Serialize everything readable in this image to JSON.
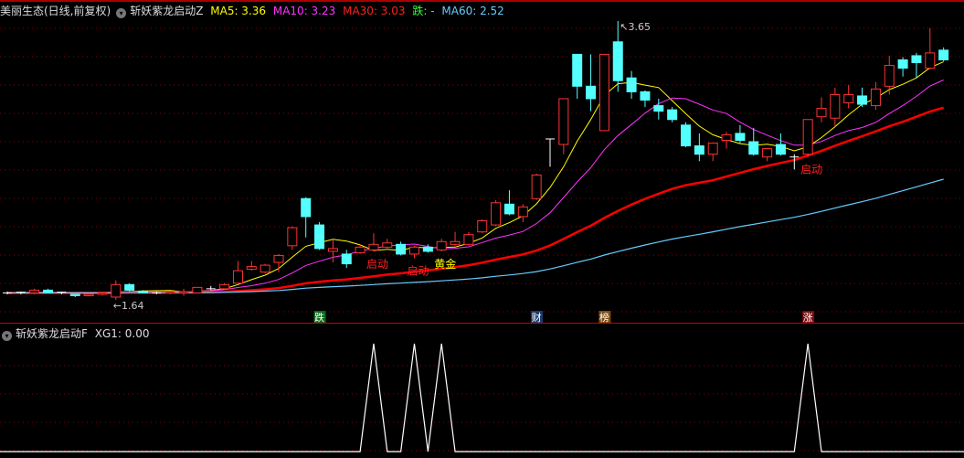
{
  "header": {
    "stock": "美丽生态(日线,前复权)",
    "indicator": "斩妖紫龙启动Z",
    "ma5_label": "MA5: 3.36",
    "ma10_label": "MA10: 3.23",
    "ma30_label": "MA30: 3.03",
    "die_label": "跌: -",
    "ma60_label": "MA60: 2.52"
  },
  "sub_header": {
    "indicator": "斩妖紫龙启动F",
    "xg1_label": "XG1: 0.00"
  },
  "colors": {
    "up": "#ff3333",
    "down": "#54ffff",
    "ma5": "#ffff00",
    "ma10": "#ff33ff",
    "ma30": "#ff0000",
    "ma60": "#66ccff",
    "grid": "#8b0000",
    "xg1": "#ffffff"
  },
  "chart_data": {
    "type": "candlestick",
    "ylim": [
      1.55,
      3.7
    ],
    "high_label": "3.65",
    "low_label": "1.64",
    "ohlc": [
      [
        1.69,
        1.7,
        1.68,
        1.69
      ],
      [
        1.69,
        1.7,
        1.68,
        1.695
      ],
      [
        1.69,
        1.72,
        1.68,
        1.71
      ],
      [
        1.71,
        1.72,
        1.69,
        1.69
      ],
      [
        1.69,
        1.7,
        1.68,
        1.695
      ],
      [
        1.68,
        1.68,
        1.66,
        1.67
      ],
      [
        1.67,
        1.69,
        1.67,
        1.68
      ],
      [
        1.68,
        1.69,
        1.67,
        1.69
      ],
      [
        1.66,
        1.78,
        1.64,
        1.75
      ],
      [
        1.75,
        1.76,
        1.7,
        1.71
      ],
      [
        1.7,
        1.71,
        1.69,
        1.69
      ],
      [
        1.69,
        1.7,
        1.68,
        1.69
      ],
      [
        1.69,
        1.7,
        1.68,
        1.7
      ],
      [
        1.69,
        1.72,
        1.67,
        1.7
      ],
      [
        1.69,
        1.73,
        1.69,
        1.73
      ],
      [
        1.72,
        1.74,
        1.71,
        1.72
      ],
      [
        1.72,
        1.76,
        1.71,
        1.75
      ],
      [
        1.76,
        1.92,
        1.76,
        1.85
      ],
      [
        1.86,
        1.92,
        1.85,
        1.88
      ],
      [
        1.84,
        1.9,
        1.83,
        1.89
      ],
      [
        1.91,
        1.97,
        1.84,
        1.96
      ],
      [
        2.03,
        2.17,
        2.0,
        2.16
      ],
      [
        2.37,
        2.38,
        2.09,
        2.24
      ],
      [
        2.18,
        2.2,
        2.0,
        2.01
      ],
      [
        1.99,
        2.07,
        1.91,
        2.01
      ],
      [
        1.97,
        2.0,
        1.87,
        1.9
      ],
      [
        1.98,
        2.04,
        1.97,
        2.02
      ],
      [
        2.0,
        2.12,
        1.99,
        2.04
      ],
      [
        2.02,
        2.08,
        2.0,
        2.05
      ],
      [
        2.04,
        2.06,
        1.96,
        1.97
      ],
      [
        1.97,
        2.03,
        1.94,
        2.02
      ],
      [
        2.02,
        2.04,
        1.98,
        1.99
      ],
      [
        2.0,
        2.08,
        1.99,
        2.06
      ],
      [
        2.04,
        2.13,
        2.03,
        2.06
      ],
      [
        2.04,
        2.13,
        2.03,
        2.11
      ],
      [
        2.13,
        2.22,
        2.12,
        2.21
      ],
      [
        2.18,
        2.36,
        2.17,
        2.34
      ],
      [
        2.33,
        2.43,
        2.25,
        2.26
      ],
      [
        2.24,
        2.33,
        2.2,
        2.31
      ],
      [
        2.37,
        2.55,
        2.36,
        2.54
      ],
      [
        2.8,
        2.8,
        2.6,
        2.8
      ],
      [
        2.76,
        3.09,
        2.69,
        3.09
      ],
      [
        3.41,
        3.41,
        3.09,
        3.18
      ],
      [
        3.18,
        3.41,
        3.0,
        3.09
      ],
      [
        2.86,
        3.41,
        2.86,
        3.41
      ],
      [
        3.5,
        3.65,
        3.14,
        3.22
      ],
      [
        3.24,
        3.29,
        3.09,
        3.14
      ],
      [
        3.14,
        3.15,
        3.03,
        3.08
      ],
      [
        3.04,
        3.09,
        2.94,
        3.0
      ],
      [
        3.01,
        3.03,
        2.92,
        2.94
      ],
      [
        2.9,
        2.92,
        2.74,
        2.75
      ],
      [
        2.75,
        2.84,
        2.64,
        2.69
      ],
      [
        2.69,
        2.77,
        2.64,
        2.77
      ],
      [
        2.79,
        2.85,
        2.73,
        2.83
      ],
      [
        2.84,
        2.9,
        2.77,
        2.79
      ],
      [
        2.78,
        2.88,
        2.68,
        2.69
      ],
      [
        2.67,
        2.73,
        2.64,
        2.73
      ],
      [
        2.76,
        2.84,
        2.68,
        2.69
      ],
      [
        2.67,
        2.69,
        2.58,
        2.67
      ],
      [
        2.69,
        2.94,
        2.67,
        2.94
      ],
      [
        2.96,
        3.1,
        2.92,
        3.02
      ],
      [
        2.95,
        3.17,
        2.89,
        3.12
      ],
      [
        3.06,
        3.19,
        3.02,
        3.12
      ],
      [
        3.11,
        3.17,
        3.03,
        3.05
      ],
      [
        3.04,
        3.21,
        3.01,
        3.16
      ],
      [
        3.18,
        3.4,
        3.12,
        3.33
      ],
      [
        3.37,
        3.39,
        3.25,
        3.31
      ],
      [
        3.4,
        3.42,
        3.24,
        3.35
      ],
      [
        3.31,
        3.6,
        3.3,
        3.42
      ],
      [
        3.44,
        3.46,
        3.36,
        3.37
      ]
    ],
    "ma_periods": [
      5,
      10,
      30,
      60
    ],
    "signals": [
      {
        "index": 27,
        "text": "启动",
        "color": "#ff2020"
      },
      {
        "index": 30,
        "text": "启动",
        "color": "#ff2020"
      },
      {
        "index": 32,
        "text": "黄金",
        "color": "#ffff00"
      },
      {
        "index": 59,
        "text": "启动",
        "color": "#ff2020"
      }
    ],
    "event_tags": [
      {
        "index": 23,
        "text": "跌",
        "bg": "#0a6a1a",
        "fg": "#ffffff"
      },
      {
        "index": 39,
        "text": "财",
        "bg": "#1a3a6a",
        "fg": "#ffffff"
      },
      {
        "index": 44,
        "text": "榜",
        "bg": "#7a4a10",
        "fg": "#ffffff"
      },
      {
        "index": 59,
        "text": "涨",
        "bg": "#7a0a0a",
        "fg": "#ffffff"
      }
    ],
    "xg1": {
      "name": "XG1",
      "signal_indices": [
        27,
        30,
        32,
        59
      ]
    }
  }
}
